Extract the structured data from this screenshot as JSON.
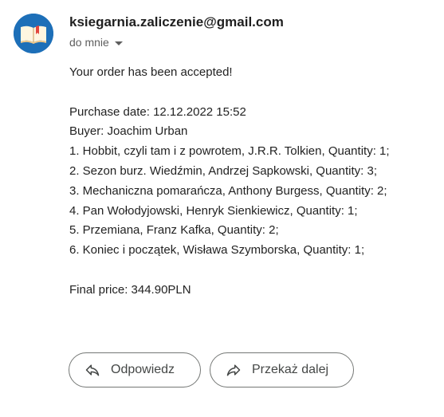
{
  "header": {
    "sender": "ksiegarnia.zaliczenie@gmail.com",
    "recipient_label": "do mnie",
    "avatar_icon": "open-book-icon",
    "avatar_color": "#1d6fb8"
  },
  "message": {
    "greeting": "Your order has been accepted!",
    "purchase_date": "Purchase date: 12.12.2022 15:52",
    "buyer": "Buyer: Joachim Urban",
    "items": [
      "1. Hobbit, czyli tam i z powrotem, J.R.R. Tolkien, Quantity: 1;",
      "2. Sezon burz. Wiedźmin, Andrzej Sapkowski, Quantity: 3;",
      "3. Mechaniczna pomarańcza, Anthony Burgess, Quantity: 2;",
      "4. Pan Wołodyjowski, Henryk Sienkiewicz, Quantity: 1;",
      "5. Przemiana, Franz Kafka, Quantity: 2;",
      "6. Koniec i początek, Wisława Szymborska, Quantity: 1;"
    ],
    "final_price": "Final price: 344.90PLN"
  },
  "actions": {
    "reply_label": "Odpowiedz",
    "reply_icon": "reply-arrow-icon",
    "forward_label": "Przekaż dalej",
    "forward_icon": "forward-arrow-icon"
  }
}
